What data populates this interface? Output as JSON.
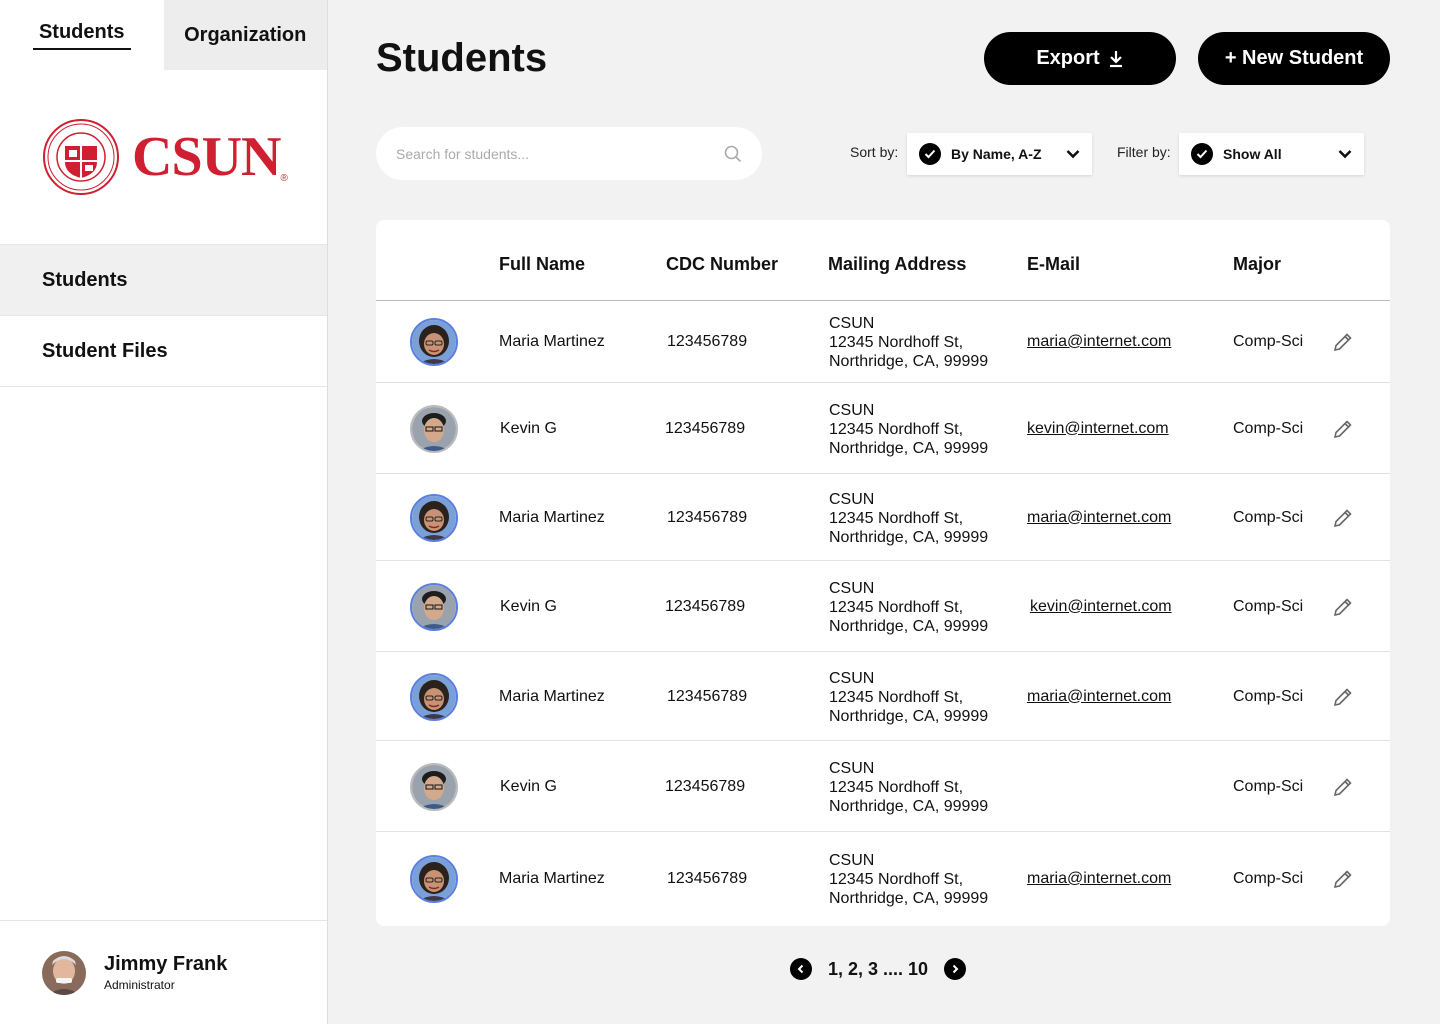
{
  "sidebar": {
    "tabs": [
      {
        "label": "Students"
      },
      {
        "label": "Organization"
      }
    ],
    "logo_text": "CSUN",
    "logo_reg": "®",
    "nav": [
      {
        "label": "Students"
      },
      {
        "label": "Student Files"
      }
    ],
    "user": {
      "name": "Jimmy Frank",
      "role": "Administrator"
    }
  },
  "header": {
    "title": "Students",
    "export_label": "Export",
    "new_label": "+ New Student"
  },
  "search": {
    "placeholder": "Search for students...",
    "value": ""
  },
  "controls": {
    "sort_label": "Sort by:",
    "sort_value": "By Name, A-Z",
    "filter_label": "Filter by:",
    "filter_value": "Show All"
  },
  "table": {
    "columns": [
      "Full Name",
      "CDC Number",
      "Mailing Address",
      "E-Mail",
      "Major"
    ],
    "rows": [
      {
        "name": "Maria Martinez",
        "cdc": "123456789",
        "addr1": "CSUN",
        "addr2": "12345 Nordhoff St,",
        "addr3": "Northridge, CA, 99999",
        "email": "maria@internet.com",
        "major": "Comp-Sci"
      },
      {
        "name": "Kevin G",
        "cdc": "123456789",
        "addr1": "CSUN",
        "addr2": "12345 Nordhoff St,",
        "addr3": "Northridge, CA, 99999",
        "email": "kevin@internet.com",
        "major": "Comp-Sci"
      },
      {
        "name": "Maria Martinez",
        "cdc": "123456789",
        "addr1": "CSUN",
        "addr2": "12345 Nordhoff St,",
        "addr3": "Northridge, CA, 99999",
        "email": "maria@internet.com",
        "major": "Comp-Sci"
      },
      {
        "name": "Kevin G",
        "cdc": "123456789",
        "addr1": "CSUN",
        "addr2": "12345 Nordhoff St,",
        "addr3": "Northridge, CA, 99999",
        "email": "kevin@internet.com",
        "major": "Comp-Sci"
      },
      {
        "name": "Maria Martinez",
        "cdc": "123456789",
        "addr1": "CSUN",
        "addr2": "12345 Nordhoff St,",
        "addr3": "Northridge, CA, 99999",
        "email": "maria@internet.com",
        "major": "Comp-Sci"
      },
      {
        "name": "Kevin G",
        "cdc": "123456789",
        "addr1": "CSUN",
        "addr2": "12345 Nordhoff St,",
        "addr3": "Northridge, CA, 99999",
        "email": "",
        "major": "Comp-Sci"
      },
      {
        "name": "Maria Martinez",
        "cdc": "123456789",
        "addr1": "CSUN",
        "addr2": "12345 Nordhoff St,",
        "addr3": "Northridge, CA, 99999",
        "email": "maria@internet.com",
        "major": "Comp-Sci"
      }
    ]
  },
  "pagination": {
    "label": "1, 2, 3 .... 10"
  },
  "colors": {
    "brand": "#cf1f30",
    "avatar_ring": "#5b7ee0",
    "button": "#000000"
  }
}
